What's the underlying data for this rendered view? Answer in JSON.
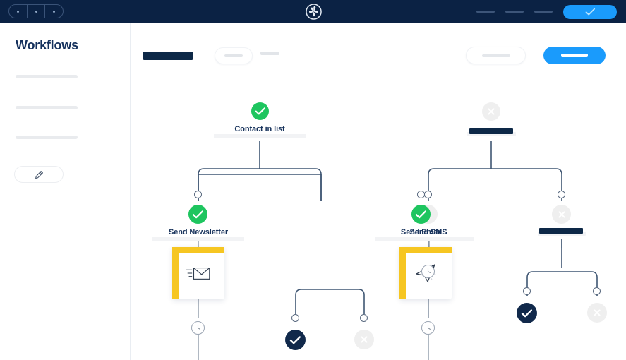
{
  "window": {
    "controls": [
      "minimize-dot",
      "maximize-dot",
      "close-dot"
    ],
    "brand_logo_icon": "sprocket-logo-icon",
    "topbar_bg": "#0b2244",
    "nav_links": [
      "",
      "",
      ""
    ],
    "cta_icon": "check-icon",
    "cta_color": "#1a9bfc"
  },
  "sidebar": {
    "title": "Workflows",
    "placeholders": [
      "",
      "",
      ""
    ],
    "edit_button_icon": "pencil-icon"
  },
  "toolbar": {
    "title_redacted": "",
    "filter_pill_label": "",
    "ghost_label": "",
    "secondary_label": "",
    "primary_label": "",
    "primary_color": "#1a9bfc"
  },
  "colors": {
    "green": "#1ec55f",
    "navy": "#11294b",
    "gray": "#efefef",
    "yellow": "#f6c622",
    "wire": "#3f5673",
    "brand_dark": "#0b2244"
  },
  "workflow": {
    "nodes": [
      {
        "id": "contact-in-list",
        "label": "Contact in list",
        "status": "success",
        "status_icon": "check-circle-icon",
        "label_style": "text"
      },
      {
        "id": "top-right-redacted",
        "label": "",
        "status": "failed",
        "status_icon": "x-circle-icon",
        "label_style": "bar"
      },
      {
        "id": "send-newsletter",
        "label": "Send Newsletter",
        "status": "success",
        "status_icon": "check-circle-icon",
        "label_style": "text"
      },
      {
        "id": "send-sms",
        "label": "Send SMS",
        "status": "failed",
        "status_icon": "x-circle-icon",
        "label_style": "text"
      },
      {
        "id": "send-email",
        "label": "Send Email",
        "status": "success",
        "status_icon": "check-circle-icon",
        "label_style": "text"
      },
      {
        "id": "branch-right-redacted",
        "label": "",
        "status": "failed",
        "status_icon": "x-circle-icon",
        "label_style": "bar"
      }
    ],
    "cards": [
      {
        "id": "newsletter-card",
        "icon": "envelope-icon",
        "accent": "#f6c622"
      },
      {
        "id": "email-card",
        "icon": "paper-plane-icon",
        "accent": "#f6c622"
      }
    ],
    "delays": [
      {
        "id": "delay-newsletter",
        "icon": "clock-icon"
      },
      {
        "id": "delay-sms",
        "icon": "clock-icon"
      },
      {
        "id": "delay-email",
        "icon": "clock-icon"
      }
    ],
    "outcomes": [
      {
        "id": "sms-branch-yes",
        "status": "confirmed",
        "status_icon": "check-circle-icon"
      },
      {
        "id": "sms-branch-no",
        "status": "failed",
        "status_icon": "x-circle-icon"
      },
      {
        "id": "right-branch-yes",
        "status": "confirmed",
        "status_icon": "check-circle-icon"
      },
      {
        "id": "right-branch-no",
        "status": "failed",
        "status_icon": "x-circle-icon"
      }
    ]
  }
}
